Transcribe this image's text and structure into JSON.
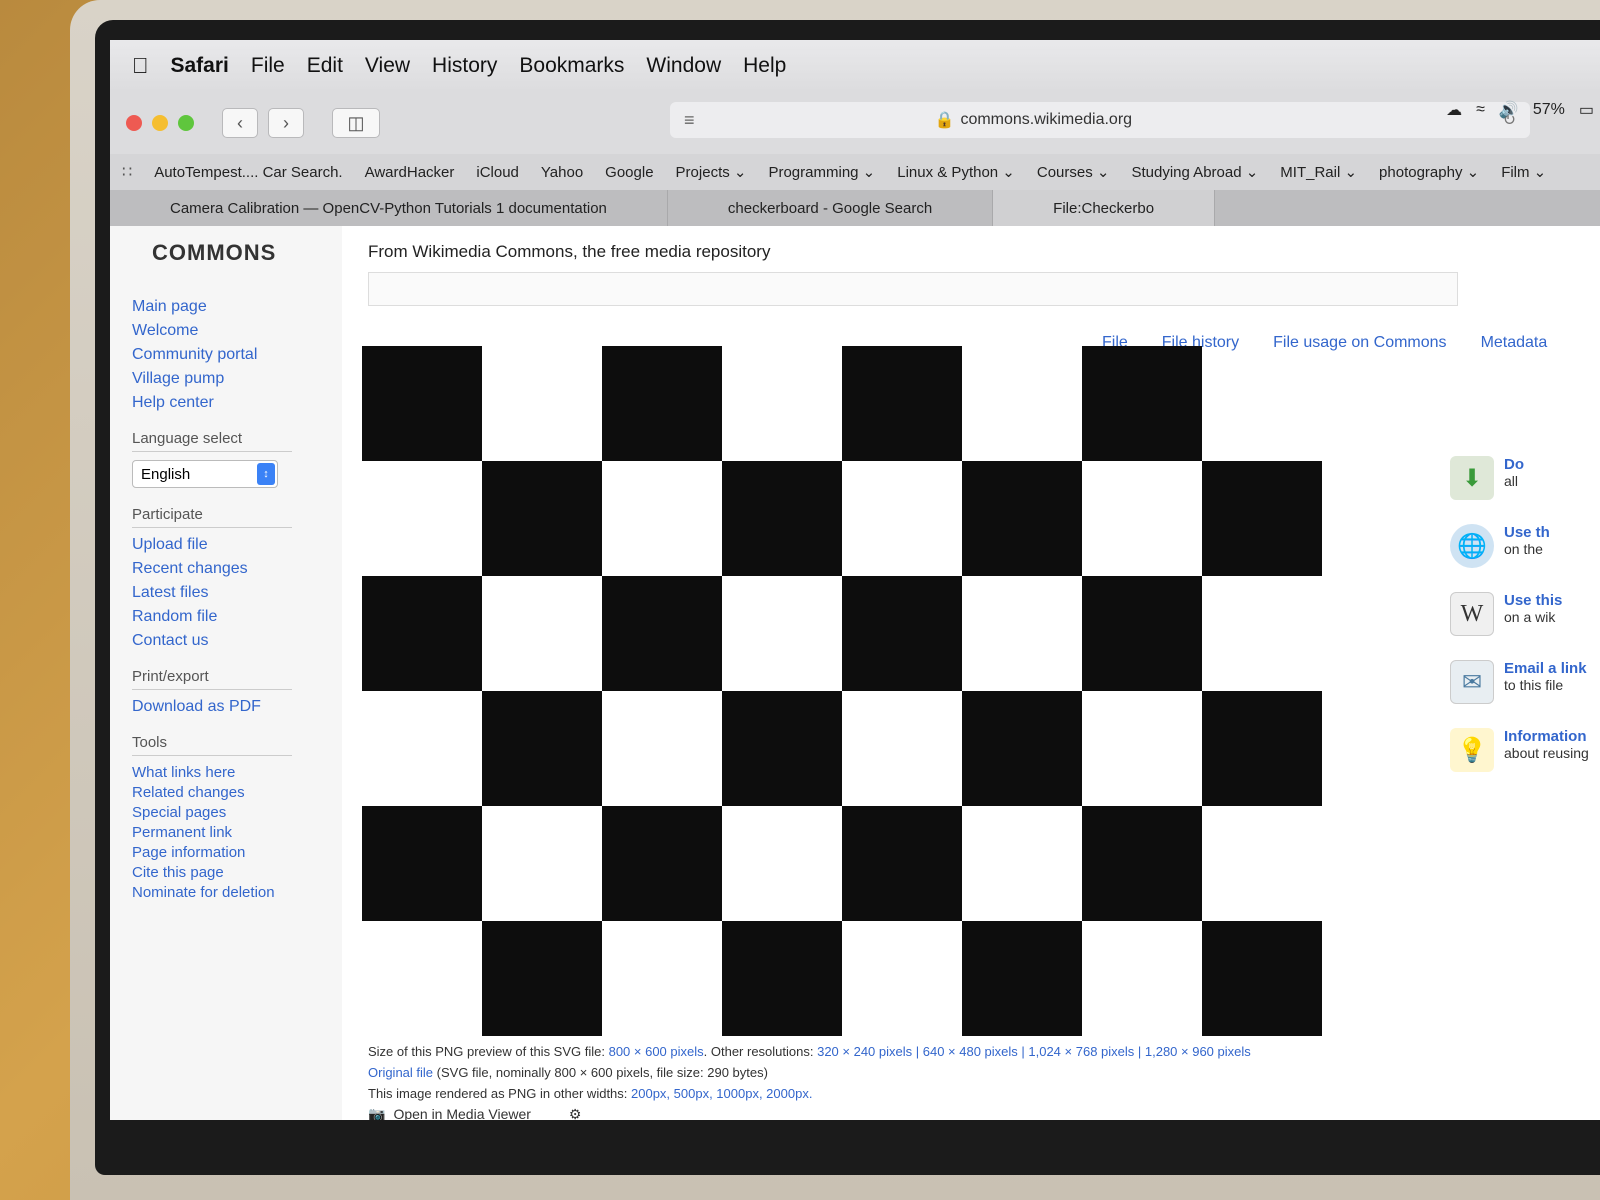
{
  "menubar": {
    "app": "Safari",
    "items": [
      "File",
      "Edit",
      "View",
      "History",
      "Bookmarks",
      "Window",
      "Help"
    ]
  },
  "address": {
    "url": "commons.wikimedia.org"
  },
  "status": {
    "battery": "57%"
  },
  "bookmarks": [
    "AutoTempest.... Car Search.",
    "AwardHacker",
    "iCloud",
    "Yahoo",
    "Google",
    "Projects ⌄",
    "Programming ⌄",
    "Linux & Python ⌄",
    "Courses ⌄",
    "Studying Abroad ⌄",
    "MIT_Rail ⌄",
    "photography ⌄",
    "Film ⌄"
  ],
  "tabs": [
    "Camera Calibration — OpenCV-Python Tutorials 1 documentation",
    "checkerboard - Google Search",
    "File:Checkerbo"
  ],
  "sidebar": {
    "logo": "COMMONS",
    "nav": [
      "Main page",
      "Welcome",
      "Community portal",
      "Village pump",
      "Help center"
    ],
    "language_heading": "Language select",
    "language_value": "English",
    "participate_heading": "Participate",
    "participate": [
      "Upload file",
      "Recent changes",
      "Latest files",
      "Random file",
      "Contact us"
    ],
    "print_heading": "Print/export",
    "print": [
      "Download as PDF"
    ],
    "tools_heading": "Tools",
    "tools": [
      "What links here",
      "Related changes",
      "Special pages",
      "Permanent link",
      "Page information",
      "Cite this page",
      "Nominate for deletion"
    ]
  },
  "content": {
    "from": "From Wikimedia Commons, the free media repository",
    "file_tabs": [
      "File",
      "File history",
      "File usage on Commons",
      "Metadata"
    ],
    "meta_line1_prefix": "Size of this PNG preview of this SVG file: ",
    "meta_line1_size": "800 × 600 pixels",
    "meta_line1_other": ". Other resolutions: ",
    "meta_line1_res": "320 × 240 pixels | 640 × 480 pixels | 1,024 × 768 pixels | 1,280 × 960 pixels",
    "meta_original": "Original file",
    "meta_original_rest": " (SVG file, nominally 800 × 600 pixels, file size: 290 bytes)",
    "meta_rendered": "This image rendered as PNG in other widths: ",
    "meta_widths": "200px, 500px, 1000px, 2000px.",
    "media_viewer": "Open in Media Viewer"
  },
  "right_panel": [
    {
      "title": "Do",
      "sub": "all",
      "icon": "download-icon"
    },
    {
      "title": "Use th",
      "sub": "on the",
      "icon": "globe-icon"
    },
    {
      "title": "Use this",
      "sub": "on a wik",
      "icon": "wikipedia-icon"
    },
    {
      "title": "Email a link",
      "sub": "to this file",
      "icon": "email-icon"
    },
    {
      "title": "Information",
      "sub": "about reusing",
      "icon": "lightbulb-icon"
    }
  ]
}
